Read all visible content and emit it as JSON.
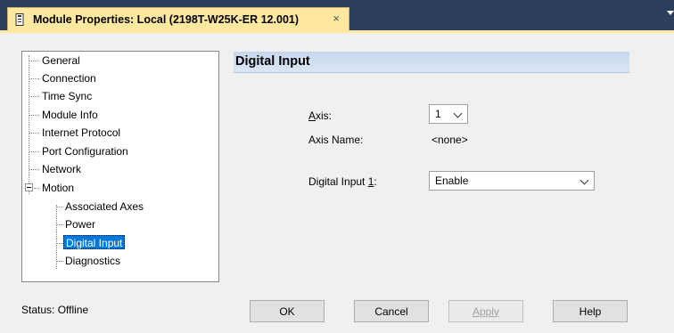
{
  "tab": {
    "title": "Module Properties: Local (2198T-W25K-ER 12.001)",
    "close_glyph": "×"
  },
  "icons": {
    "tab": "document-icon",
    "close": "close-icon",
    "overflow": "chevron-down-icon",
    "tree_expander": "collapse-icon",
    "combo_chevron": "chevron-down-icon"
  },
  "colors": {
    "tab_bg": "#ffe9a0",
    "titlebar_bg": "#2b3e5c",
    "selection": "#0078d7",
    "header_gradient": "#c6d7ee"
  },
  "tree": {
    "items": [
      {
        "label": "General"
      },
      {
        "label": "Connection"
      },
      {
        "label": "Time Sync"
      },
      {
        "label": "Module Info"
      },
      {
        "label": "Internet Protocol"
      },
      {
        "label": "Port Configuration"
      },
      {
        "label": "Network"
      },
      {
        "label": "Motion"
      },
      {
        "label": "Associated Axes"
      },
      {
        "label": "Power"
      },
      {
        "label": "Digital Input"
      },
      {
        "label": "Diagnostics"
      }
    ],
    "selected": "Digital Input"
  },
  "section": {
    "title": "Digital Input"
  },
  "form": {
    "axis_label_pre": "",
    "axis_label_accel": "A",
    "axis_label_post": "xis:",
    "axis_value": "1",
    "axis_name_label": "Axis Name:",
    "axis_name_value": "<none>",
    "di_label_pre": "Digital Input ",
    "di_label_accel": "1",
    "di_label_post": ":",
    "di_value": "Enable"
  },
  "status": {
    "text": "Status:  Offline"
  },
  "buttons": {
    "ok": "OK",
    "cancel": "Cancel",
    "apply": "Apply",
    "help": "Help"
  }
}
